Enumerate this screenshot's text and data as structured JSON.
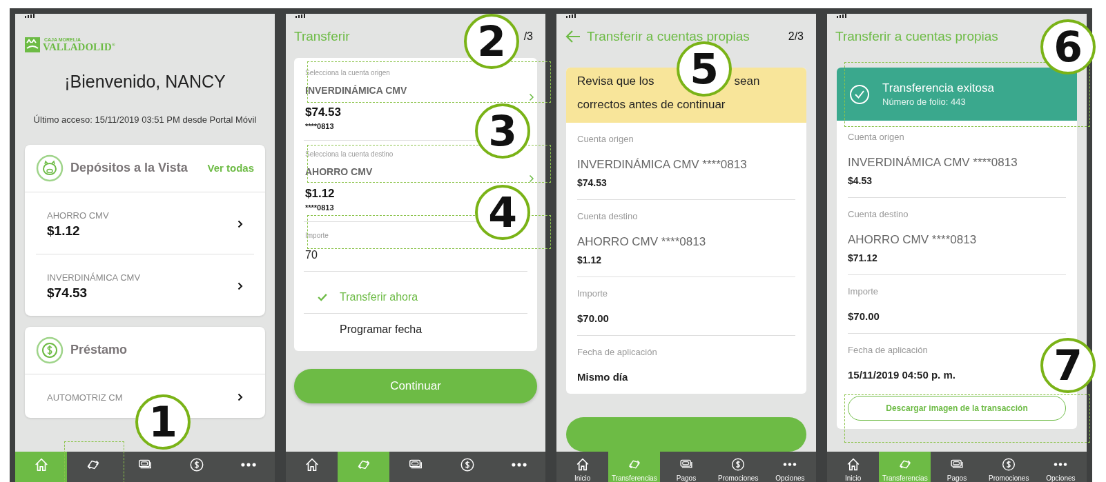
{
  "screens": [
    {
      "kind": "home",
      "logo": {
        "top": "CAJA MORELIA",
        "name": "VALLADOLID",
        "mark": "®"
      },
      "greeting": "¡Bienvenido, NANCY",
      "last_access": "Último acceso: 15/11/2019 03:51 PM desde Portal Móvil",
      "cards": [
        {
          "kind": "deposits",
          "title": "Depósitos a la Vista",
          "link": "Ver todas",
          "rows": [
            {
              "name": "AHORRO CMV",
              "amount": "$1.12"
            },
            {
              "name": "INVERDINÁMICA CMV",
              "amount": "$74.53"
            }
          ]
        },
        {
          "kind": "loan",
          "title": "Préstamo",
          "rows": [
            {
              "name": "AUTOMOTRIZ CM"
            }
          ]
        }
      ],
      "nav": [
        {
          "kind": "home",
          "selected": true
        },
        {
          "kind": "transfer",
          "selected": false
        },
        {
          "kind": "bills",
          "selected": false
        },
        {
          "kind": "promo",
          "selected": false
        },
        {
          "kind": "more",
          "selected": false
        }
      ]
    },
    {
      "kind": "form",
      "title": "Transferir",
      "step": "/3",
      "accounts": [
        {
          "label": "Selecciona la cuenta origen",
          "value": "INVERDINÁMICA CMV",
          "amount": "$74.53",
          "number": "****0813"
        },
        {
          "label": "Selecciona la cuenta destino",
          "value": "AHORRO CMV",
          "amount": "$1.12",
          "number": "****0813"
        }
      ],
      "amount_field": {
        "label": "Importe",
        "value": "70"
      },
      "options": [
        {
          "label": "Transferir ahora",
          "selected": true
        },
        {
          "label": "Programar fecha",
          "selected": false
        }
      ],
      "button": "Continuar",
      "nav": [
        {
          "kind": "home",
          "selected": false
        },
        {
          "kind": "transfer",
          "selected": true
        },
        {
          "kind": "bills",
          "selected": false
        },
        {
          "kind": "promo",
          "selected": false
        },
        {
          "kind": "more",
          "selected": false
        }
      ]
    },
    {
      "kind": "review",
      "title": "Transferir a cuentas propias",
      "step": "2/3",
      "notice": [
        "Revisa que los",
        "sean",
        "correctos antes de continuar"
      ],
      "sections": [
        {
          "label": "Cuenta origen",
          "value": "INVERDINÁMICA CMV ****0813",
          "amount": "$74.53"
        },
        {
          "label": "Cuenta destino",
          "value": "AHORRO CMV ****0813",
          "amount": "$1.12"
        },
        {
          "label": "Importe",
          "amount": "$70.00"
        },
        {
          "label": "Fecha de aplicación",
          "amount": "Mismo día"
        }
      ],
      "nav": [
        {
          "kind": "home",
          "label": "Inicio",
          "selected": false
        },
        {
          "kind": "transfer",
          "label": "Transferencias",
          "selected": true
        },
        {
          "kind": "bills",
          "label": "Pagos",
          "selected": false
        },
        {
          "kind": "promo",
          "label": "Promociones",
          "selected": false
        },
        {
          "kind": "more",
          "label": "Opciones",
          "selected": false
        }
      ]
    },
    {
      "kind": "success",
      "title": "Transferir a cuentas propias",
      "banner": {
        "title": "Transferencia exitosa",
        "subtitle": "Número de folio: 443"
      },
      "sections": [
        {
          "label": "Cuenta origen",
          "value": "INVERDINÁMICA CMV ****0813",
          "amount": "$4.53"
        },
        {
          "label": "Cuenta destino",
          "value": "AHORRO CMV ****0813",
          "amount": "$71.12"
        },
        {
          "label": "Importe",
          "amount": "$70.00"
        },
        {
          "label": "Fecha de aplicación",
          "amount": "15/11/2019 04:50 p. m."
        }
      ],
      "button": "Descargar imagen de la transacción",
      "nav": [
        {
          "kind": "home",
          "label": "Inicio",
          "selected": false
        },
        {
          "kind": "transfer",
          "label": "Transferencias",
          "selected": true
        },
        {
          "kind": "bills",
          "label": "Pagos",
          "selected": false
        },
        {
          "kind": "promo",
          "label": "Promociones",
          "selected": false
        },
        {
          "kind": "more",
          "label": "Opciones",
          "selected": false
        }
      ]
    }
  ],
  "callouts": [
    "1",
    "2",
    "3",
    "4",
    "5",
    "6",
    "7"
  ]
}
